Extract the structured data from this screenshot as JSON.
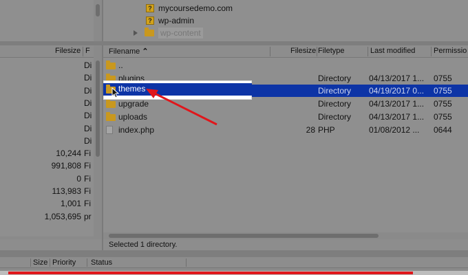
{
  "remote_tree": {
    "items": [
      {
        "label": "mycoursedemo.com",
        "icon": "question-folder-icon"
      },
      {
        "label": "wp-admin",
        "icon": "question-folder-icon"
      },
      {
        "label": "wp-content",
        "icon": "folder-icon",
        "selected": true
      }
    ]
  },
  "local_list": {
    "headers": {
      "filesize": "Filesize",
      "filetype": "F"
    },
    "rows": [
      {
        "size": "",
        "type": "Di"
      },
      {
        "size": "",
        "type": "Di"
      },
      {
        "size": "",
        "type": "Di"
      },
      {
        "size": "",
        "type": "Di"
      },
      {
        "size": "",
        "type": "Di"
      },
      {
        "size": "",
        "type": "Di"
      },
      {
        "size": "",
        "type": "Di"
      },
      {
        "size": "10,244",
        "type": "Fi"
      },
      {
        "size": "991,808",
        "type": "Fi"
      },
      {
        "size": "0",
        "type": "Fi"
      },
      {
        "size": "113,983",
        "type": "Fi"
      },
      {
        "size": "1,001",
        "type": "Fi"
      },
      {
        "size": "1,053,695",
        "type": "pr"
      }
    ]
  },
  "remote_list": {
    "headers": {
      "filename": "Filename",
      "sort_indicator": "^",
      "filesize": "Filesize",
      "filetype": "Filetype",
      "last_modified": "Last modified",
      "permissions": "Permissio"
    },
    "rows": [
      {
        "name": "..",
        "size": "",
        "type": "",
        "modified": "",
        "perms": "",
        "icon": "folder-icon"
      },
      {
        "name": "plugins",
        "size": "",
        "type": "Directory",
        "modified": "04/13/2017 1...",
        "perms": "0755",
        "icon": "folder-icon"
      },
      {
        "name": "themes",
        "size": "",
        "type": "Directory",
        "modified": "04/19/2017 0...",
        "perms": "0755",
        "icon": "folder-icon",
        "selected": true
      },
      {
        "name": "upgrade",
        "size": "",
        "type": "Directory",
        "modified": "04/13/2017 1...",
        "perms": "0755",
        "icon": "folder-icon"
      },
      {
        "name": "uploads",
        "size": "",
        "type": "Directory",
        "modified": "04/13/2017 1...",
        "perms": "0755",
        "icon": "folder-icon"
      },
      {
        "name": "index.php",
        "size": "28",
        "type": "PHP",
        "modified": "01/08/2012 ...",
        "perms": "0644",
        "icon": "file-icon"
      }
    ]
  },
  "status": {
    "text": "Selected 1 directory."
  },
  "queue": {
    "headers": {
      "size": "Size",
      "priority": "Priority",
      "status": "Status"
    }
  },
  "video_progress": {
    "fraction": 0.88,
    "color": "#e0161b"
  },
  "colors": {
    "selection": "#0d34a6",
    "arrow": "#e0161b"
  }
}
